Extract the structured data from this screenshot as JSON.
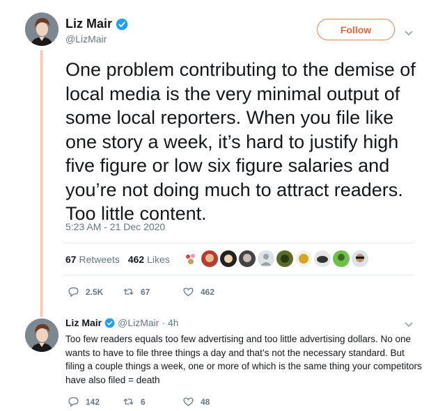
{
  "main": {
    "name": "Liz Mair",
    "handle": "@LizMair",
    "follow_label": "Follow",
    "text": "One problem contributing to the demise of local media is the very minimal output of some local reporters. When you file like one story a week, it’s hard to justify high five figure or low six figure salaries and you’re not doing much to attract readers. Too little content.",
    "timestamp": "5:23 AM - 21 Dec 2020",
    "retweets_count": "67",
    "retweets_label": "Retweets",
    "likes_count": "462",
    "likes_label": "Likes",
    "reply_count": "2.5K",
    "retweet_action_count": "67",
    "like_action_count": "462"
  },
  "reply": {
    "name": "Liz Mair",
    "handle": "@LizMair",
    "time": "· 4h",
    "text": "Too few readers equals too few advertising and too little advertising dollars. No one wants to have to file three things a day and that’s not the necessary standard. But filing a couple things a week, one or more of which is the same thing your competitors have also filed = death",
    "reply_count": "142",
    "retweet_count": "6",
    "like_count": "48"
  },
  "icons": {
    "verified": "verified-badge-icon",
    "chevron": "chevron-down-icon",
    "reply": "reply-icon",
    "retweet": "retweet-icon",
    "like": "heart-icon"
  },
  "colors": {
    "accent": "#e06a38",
    "verified": "#1da1f2",
    "thread_line": "#f7c6ac",
    "secondary_text": "#657786"
  }
}
